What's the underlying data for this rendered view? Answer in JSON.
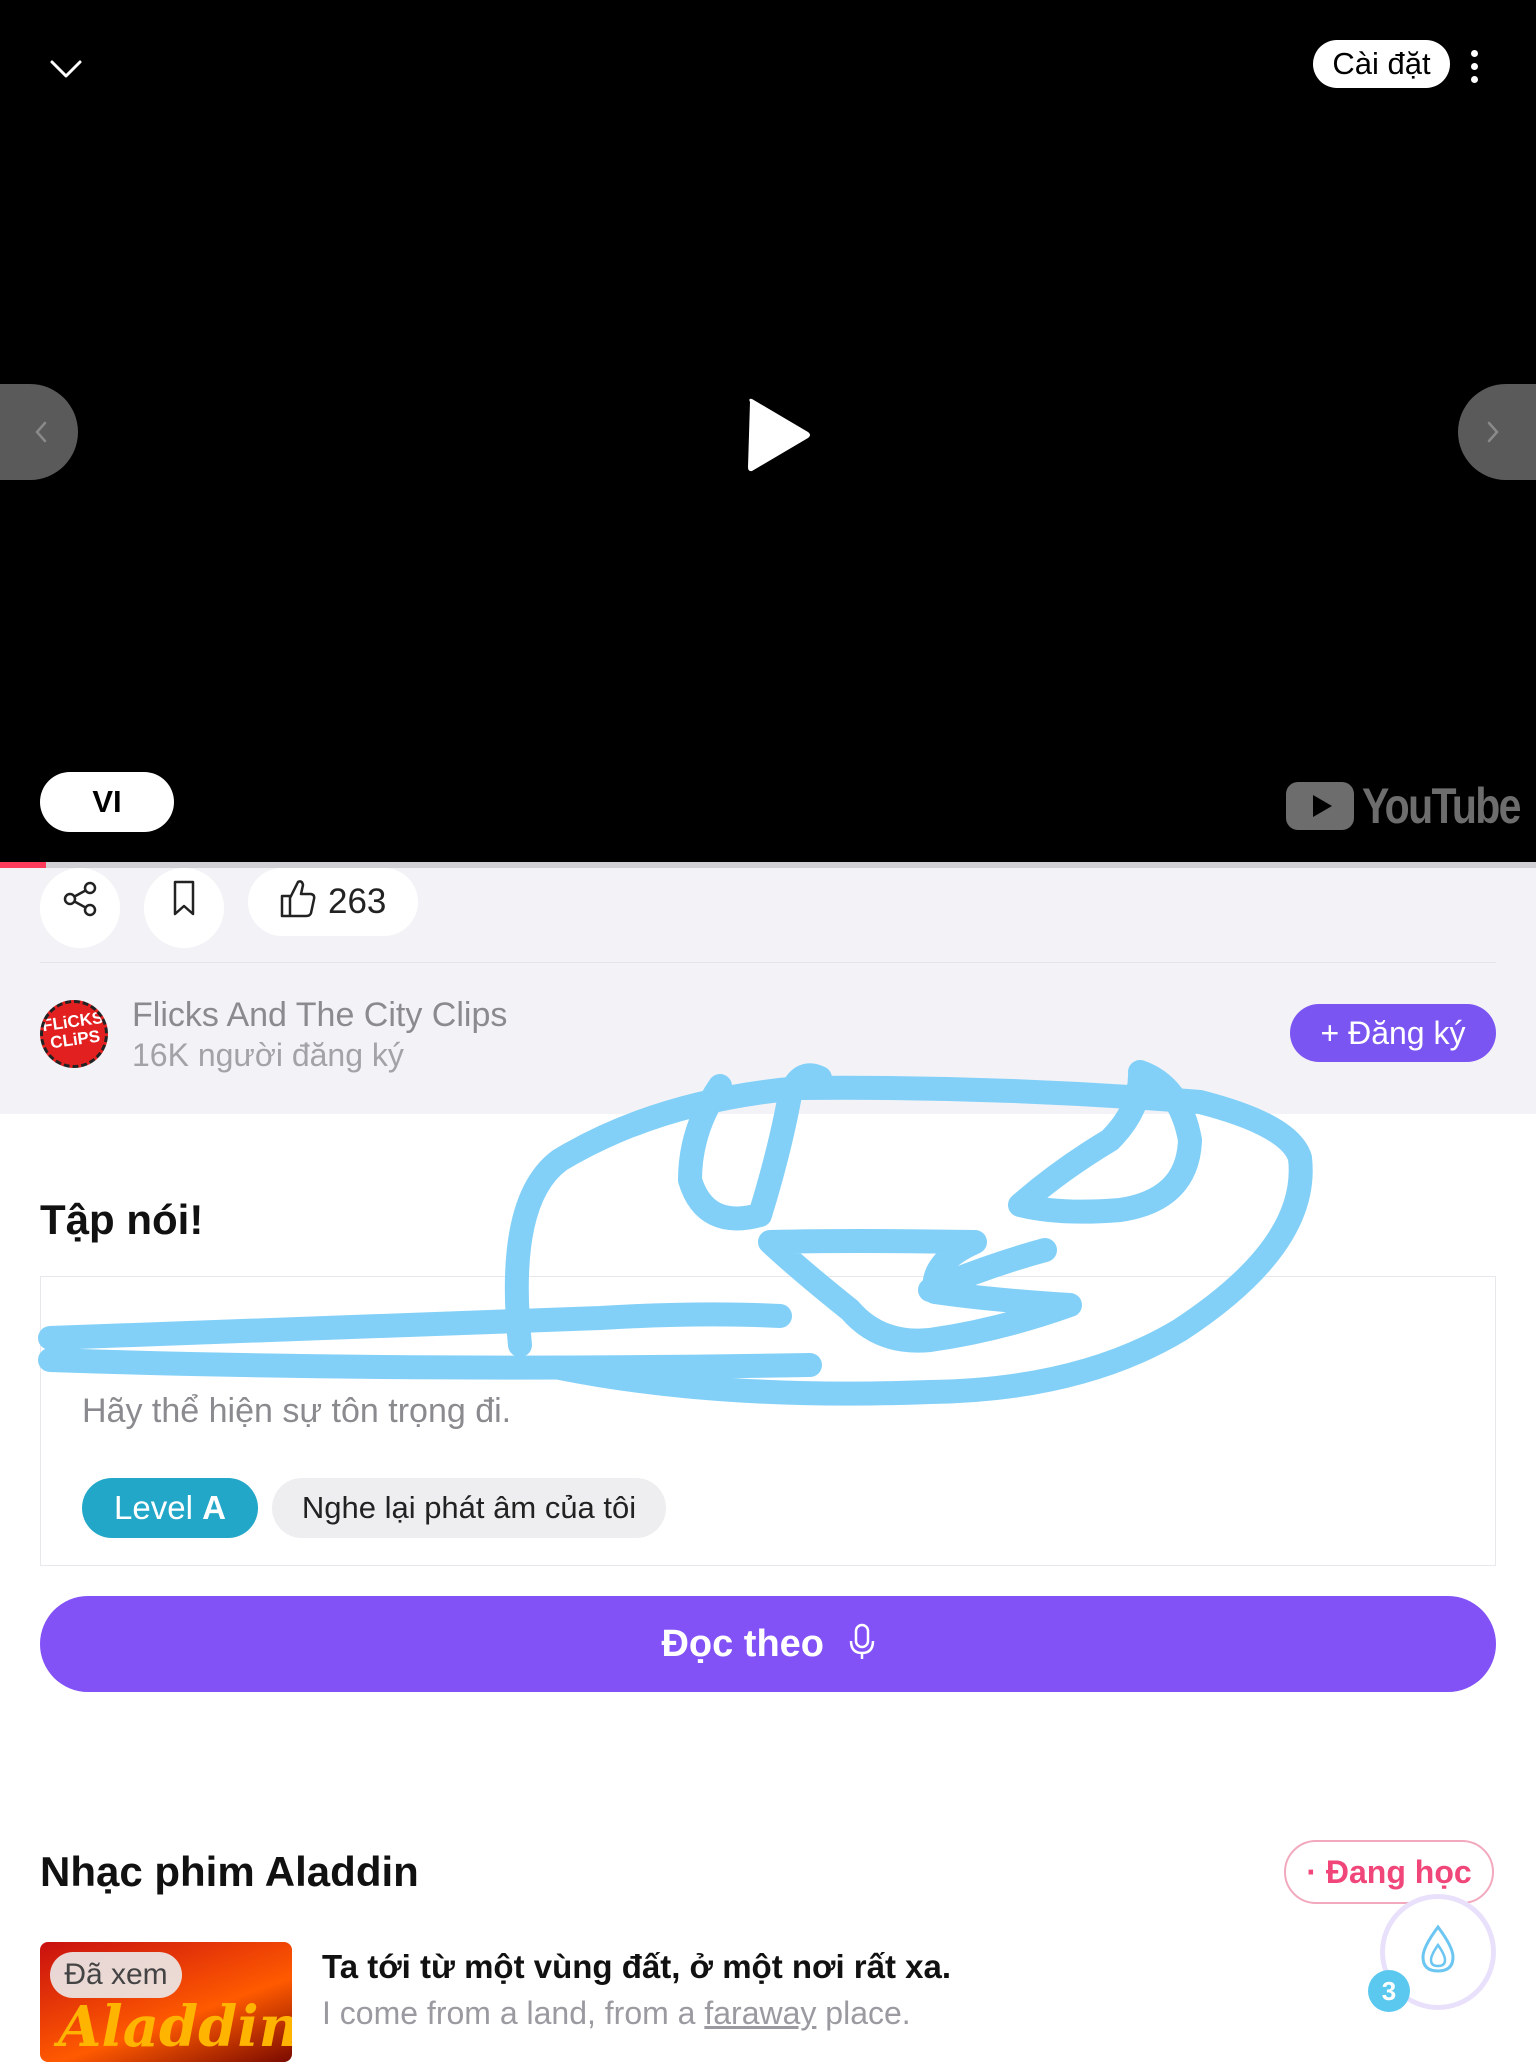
{
  "video": {
    "settings_label": "Cài đặt",
    "subtitle_lang": "VI",
    "youtube_brand": "YouTube",
    "progress_fraction": 0.03
  },
  "actions": {
    "like_count": "263"
  },
  "channel": {
    "avatar_text": "FLiCKS CLiPS",
    "name": "Flicks And The City Clips",
    "subscribers": "16K người đăng ký",
    "subscribe_label": "+ Đăng ký"
  },
  "speak": {
    "title": "Tập nói!",
    "sentence": "Hãy thể hiện sự tôn trọng đi.",
    "level_prefix": "Level",
    "level_value": "A",
    "replay_label": "Nghe lại phát âm của tôi",
    "read_button": "Đọc theo"
  },
  "playlist": {
    "title": "Nhạc phim Aladdin",
    "status_badge": "· Đang học",
    "items": [
      {
        "watched_badge": "Đã xem",
        "thumb_text": "Aladdin",
        "title_vi": "Ta tới từ một vùng đất, ở một nơi rất xa.",
        "title_en_before": "I come from a land, from a ",
        "title_en_highlight": "faraway",
        "title_en_after": " place."
      }
    ]
  },
  "fab": {
    "count": "3"
  },
  "colors": {
    "accent_purple": "#8352f7",
    "level_teal": "#22a7c8",
    "badge_pink": "#f0467a",
    "progress_red": "#ff3b5c",
    "scribble_blue": "#82d0f8"
  }
}
